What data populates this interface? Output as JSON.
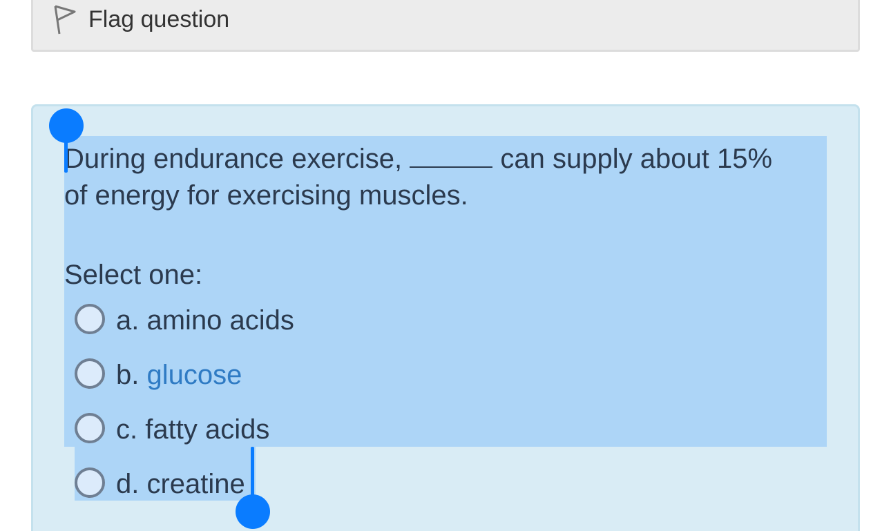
{
  "flag": {
    "label": "Flag question",
    "icon": "flag-icon"
  },
  "question": {
    "text_before": "During endurance exercise,",
    "text_after": "can supply about 15%",
    "text_line2": "of energy for exercising muscles.",
    "prompt": "Select one:",
    "options": [
      {
        "letter": "a.",
        "text": "amino acids"
      },
      {
        "letter": "b.",
        "text": "glucose"
      },
      {
        "letter": "c.",
        "text": "fatty acids"
      },
      {
        "letter": "d.",
        "text": "creatine"
      }
    ]
  },
  "colors": {
    "selection": "#add5f7",
    "handle": "#0a7cff",
    "panel": "#d9ecf5",
    "link": "#2f7bc4"
  }
}
